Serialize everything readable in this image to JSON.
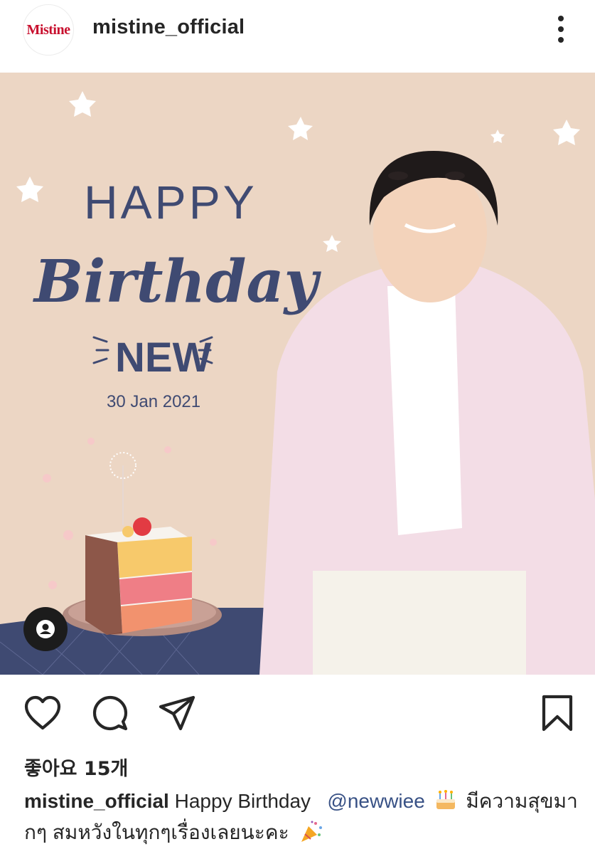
{
  "header": {
    "avatar_logo": "Mistine",
    "username": "mistine_official"
  },
  "post_image": {
    "greeting_line1": "HAPPY",
    "greeting_line2": "Birthday",
    "name": "NEW",
    "date": "30 Jan 2021"
  },
  "actions": {
    "icons": [
      "heart-icon",
      "comment-icon",
      "share-icon",
      "bookmark-icon"
    ]
  },
  "likes": {
    "text": "좋아요 15개"
  },
  "caption": {
    "username": "mistine_official",
    "text": "Happy Birthday",
    "mention": "@newwiee",
    "text2": "มีความสุขมากๆ สมหวังในทุกๆเรื่องเลยนะคะ"
  },
  "colors": {
    "background_peach": "#ecd6c4",
    "navy": "#3f4a72",
    "mention": "#385185",
    "brand_red": "#c8102e"
  }
}
